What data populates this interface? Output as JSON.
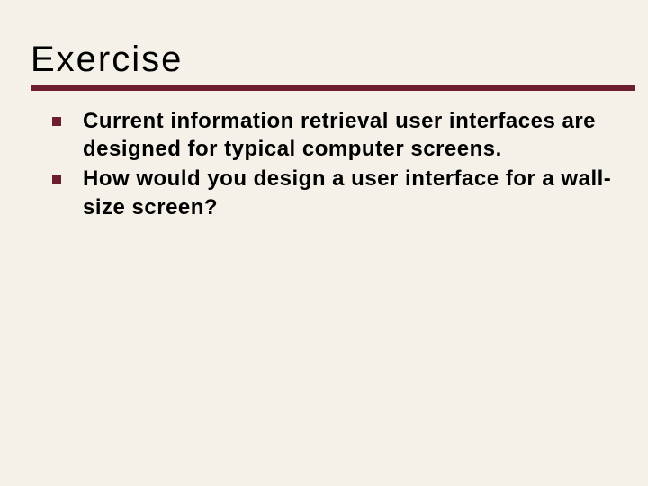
{
  "colors": {
    "accent": "#6c1d2e",
    "background": "#f5f1e9"
  },
  "title": "Exercise",
  "bullets": [
    "Current information retrieval user interfaces are designed for typical computer screens.",
    "How would you design a user interface for a wall-size screen?"
  ]
}
